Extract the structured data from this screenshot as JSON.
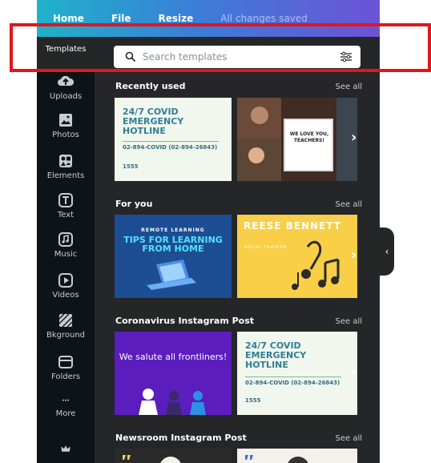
{
  "topbar": {
    "home": "Home",
    "file": "File",
    "resize": "Resize",
    "saved": "All changes saved"
  },
  "sidebar": {
    "items": [
      {
        "label": "Templates",
        "icon": "templates-icon"
      },
      {
        "label": "Uploads",
        "icon": "upload-icon"
      },
      {
        "label": "Photos",
        "icon": "photo-icon"
      },
      {
        "label": "Elements",
        "icon": "shapes-icon"
      },
      {
        "label": "Text",
        "icon": "text-icon"
      },
      {
        "label": "Music",
        "icon": "music-icon"
      },
      {
        "label": "Videos",
        "icon": "video-icon"
      },
      {
        "label": "Bkground",
        "icon": "background-icon"
      },
      {
        "label": "Folders",
        "icon": "folder-icon"
      },
      {
        "label": "More",
        "icon": "more-icon"
      }
    ],
    "bottom_icon": "crown-icon"
  },
  "search": {
    "placeholder": "Search templates"
  },
  "sections": [
    {
      "title": "Recently used",
      "see_all": "See all"
    },
    {
      "title": "For you",
      "see_all": "See all"
    },
    {
      "title": "Coronavirus Instagram Post",
      "see_all": "See all"
    },
    {
      "title": "Newsroom Instagram Post",
      "see_all": "See all"
    }
  ],
  "templates": {
    "covid": {
      "headline": "24/7 COVID EMERGENCY HOTLINE",
      "phone": "02-894-COVID (02-894-26843)",
      "number": "1555"
    },
    "teachers": {
      "text": "WE LOVE YOU, TEACHERS!"
    },
    "remote": {
      "line1": "REMOTE LEARNING",
      "line2": "TIPS FOR LEARNING FROM HOME"
    },
    "reese": {
      "name": "REESE BENNETT",
      "role": "VOCAL TRAINER"
    },
    "salute": {
      "headline": "We salute all frontliners!"
    }
  },
  "colors": {
    "accent_red": "#e3151a",
    "panel": "#252627",
    "sidebar": "#0e1318"
  }
}
